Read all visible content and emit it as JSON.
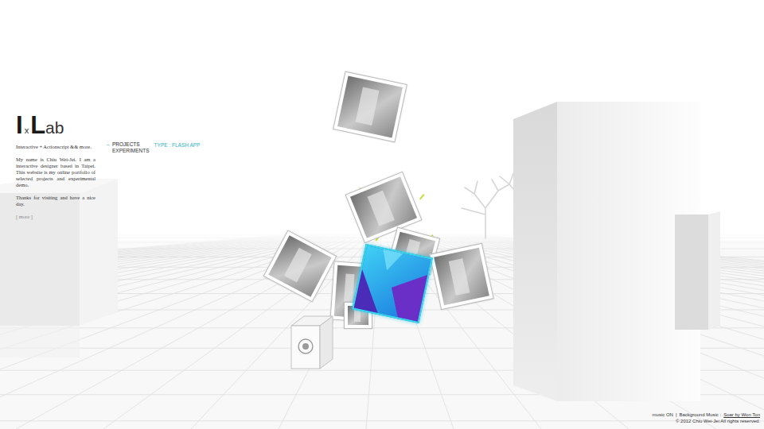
{
  "logo": [
    {
      "text": "I",
      "kind": "big"
    },
    {
      "text": "x",
      "kind": "small"
    },
    {
      "text": "L",
      "kind": "big"
    },
    {
      "text": "ab",
      "kind": "medium"
    }
  ],
  "tagline": "Interactive + Actionscript && more.",
  "intro": [
    "My name is Chiu Wei-Jei. I am a interactive designer based in Taipei. This website is my online portfolio of selected projects and experimental demo.",
    "Thanks for visiting and have a nice day."
  ],
  "more_link": "[ more ]",
  "nav": {
    "marker": "–",
    "items": [
      {
        "label": "PROJECTS",
        "selected": true
      },
      {
        "label": "EXPERIMENTS",
        "selected": false
      }
    ]
  },
  "type_label": "TYPE : FLASH APP",
  "cards": [
    {
      "kind": "photo",
      "selected": false
    },
    {
      "kind": "photo",
      "selected": false
    },
    {
      "kind": "photo",
      "selected": false
    },
    {
      "kind": "photo",
      "selected": false
    },
    {
      "kind": "photo",
      "selected": false
    },
    {
      "kind": "photo",
      "selected": false
    },
    {
      "kind": "cube",
      "selected": false
    },
    {
      "kind": "photo",
      "selected": false
    },
    {
      "kind": "photo",
      "selected": true
    }
  ],
  "footer": {
    "music_toggle": "music ON",
    "separator": "|",
    "music_label": "Background Music :",
    "music_link": "Soar by Won Ton",
    "copyright": "© 2012 Chiu Wei-Jei All rights reserved."
  }
}
